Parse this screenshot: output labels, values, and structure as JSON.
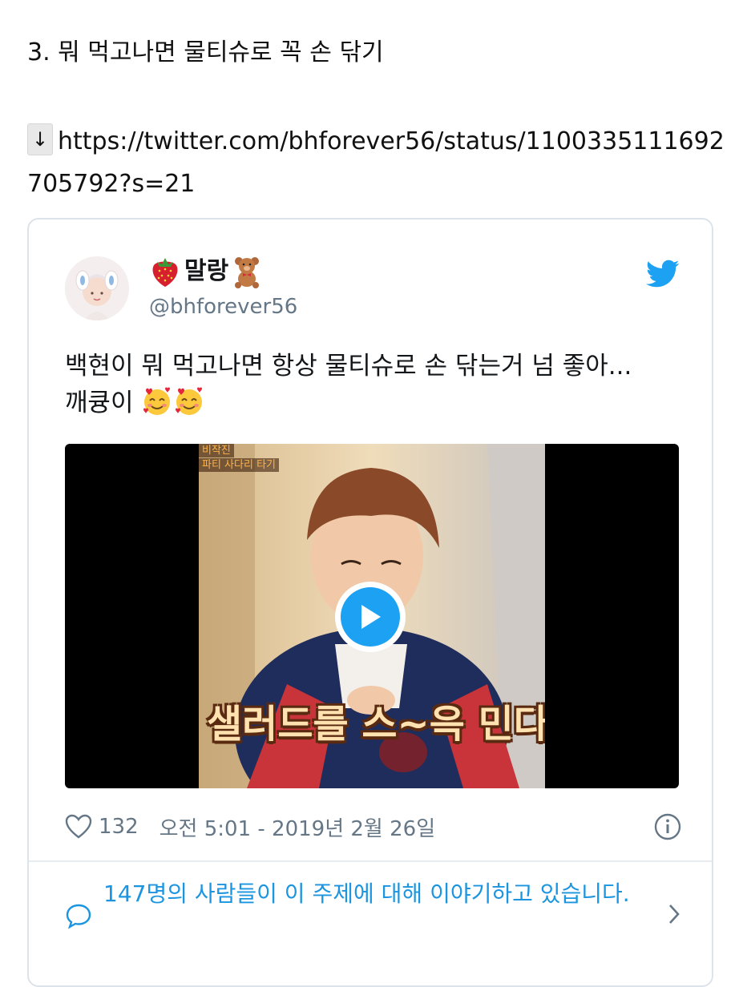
{
  "heading": "3. 뭐 먹고나면 물티슈로 꼭 손 닦기",
  "link": {
    "arrow": "↓",
    "url": "https://twitter.com/bhforever56/status/1100335111692705792?s=21"
  },
  "tweet": {
    "display_name": "말랑",
    "handle": "@bhforever56",
    "text_line1": "백현이 뭐 먹고나면 항상 물티슈로 손 닦는거 넘 좋아...",
    "text_line2": "깨큥이",
    "video": {
      "overlay_tag1": "비작진",
      "overlay_tag2": "파티 사다리 타기",
      "caption": "샐러드를 스~윽 민다"
    },
    "like_count": "132",
    "timestamp": "오전 5:01 - 2019년 2월 26일",
    "conversation_text": "147명의 사람들이 이 주제에 대해 이야기하고 있습니다."
  },
  "colors": {
    "accent": "#1da1f2",
    "link_text": "#1b95e0",
    "meta_text": "#657786",
    "card_border": "#dde3ea"
  },
  "icons": [
    "strawberry-emoji",
    "teddy-bear-emoji",
    "twitter-bird-icon",
    "smiling-face-with-hearts-emoji",
    "play-icon",
    "heart-icon",
    "info-icon",
    "speech-bubble-icon",
    "chevron-right-icon"
  ]
}
